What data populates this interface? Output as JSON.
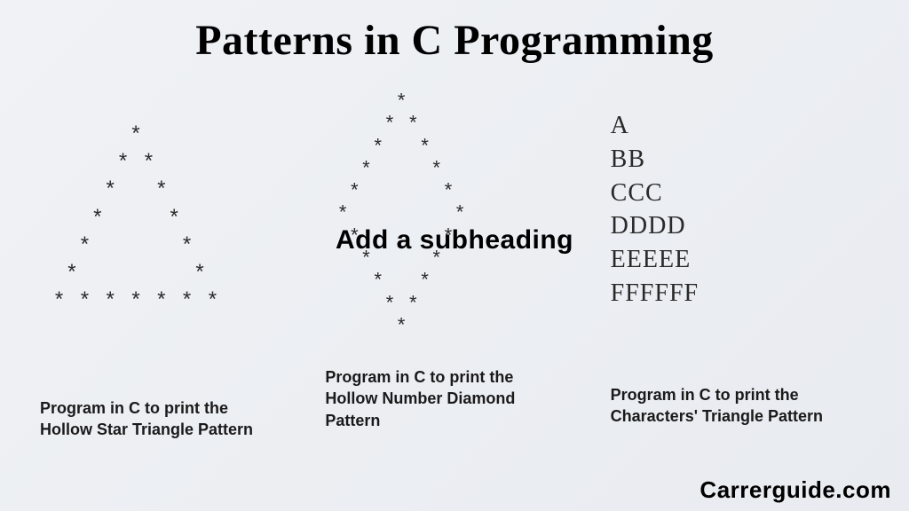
{
  "title": "Patterns in C Programming",
  "overlay": "Add a subheading",
  "watermark": "Carrerguide.com",
  "columns": [
    {
      "pattern": "       *\n      * *\n     *   *\n    *     *\n   *       *\n  *         *\n * * * * * * *",
      "caption": "Program in C to print the Hollow Star Triangle Pattern"
    },
    {
      "pattern": "      *\n     * *\n    *   *\n   *     *\n  *       *\n *         *\n  *       *\n   *     *\n    *   *\n     * *\n      *",
      "caption": "Program in C to print the Hollow  Number Diamond Pattern"
    },
    {
      "pattern": "A\nBB\nCCC\nDDDD\nEEEEE\nFFFFFF",
      "caption": "Program in C to print the Characters' Triangle Pattern"
    }
  ]
}
